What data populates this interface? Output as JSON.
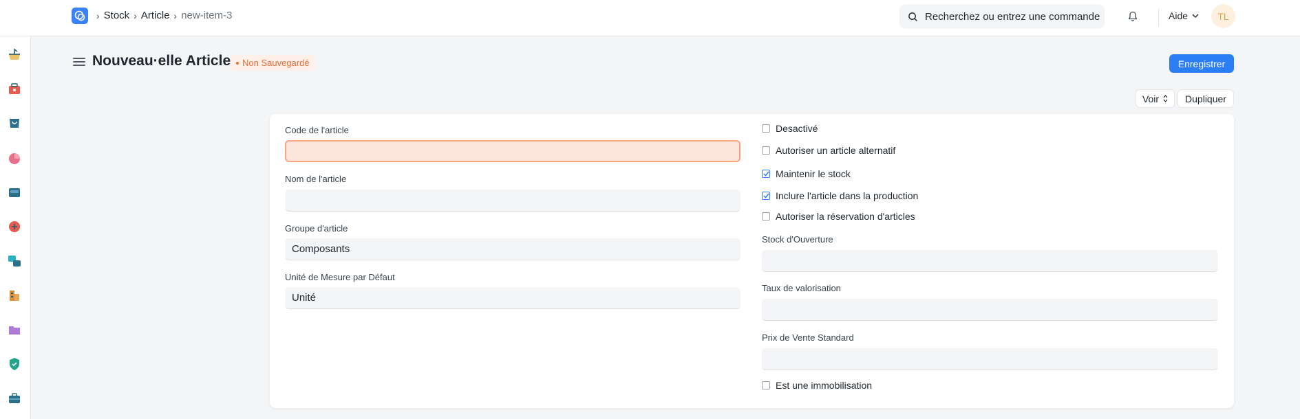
{
  "breadcrumb": {
    "items": [
      "Stock",
      "Article"
    ],
    "current": "new-item-3"
  },
  "search": {
    "placeholder": "Recherchez ou entrez une commande"
  },
  "help": {
    "label": "Aide"
  },
  "user": {
    "initials": "TL"
  },
  "page": {
    "title": "Nouveau·elle Article",
    "status": "Non Sauvegardé",
    "save_label": "Enregistrer",
    "view_label": "Voir",
    "duplicate_label": "Dupliquer"
  },
  "sidebar": {
    "icons": [
      "stock-icon",
      "selling-icon",
      "buying-icon",
      "accounting-icon",
      "hr-icon",
      "support-icon",
      "projects-icon",
      "manufacturing-icon",
      "folder-icon",
      "quality-icon",
      "tools-icon"
    ]
  },
  "form": {
    "left": [
      {
        "label": "Code de l'article",
        "value": ""
      },
      {
        "label": "Nom de l'article",
        "value": ""
      },
      {
        "label": "Groupe d'article",
        "value": "Composants"
      },
      {
        "label": "Unité de Mesure par Défaut",
        "value": "Unité"
      }
    ],
    "checks": [
      {
        "label": "Desactivé",
        "checked": false
      },
      {
        "label": "Autoriser un article alternatif",
        "checked": false
      },
      {
        "label": "Maintenir le stock",
        "checked": true
      },
      {
        "label": "Inclure l'article dans la production",
        "checked": true
      },
      {
        "label": "Autoriser la réservation d'articles",
        "checked": false
      }
    ],
    "right": [
      {
        "label": "Stock d'Ouverture",
        "value": ""
      },
      {
        "label": "Taux de valorisation",
        "value": ""
      },
      {
        "label": "Prix de Vente Standard",
        "value": ""
      }
    ],
    "last_check": {
      "label": "Est une immobilisation",
      "checked": false
    }
  },
  "colors": {
    "primary": "#2b7ef4",
    "warning": "#e86c36"
  }
}
